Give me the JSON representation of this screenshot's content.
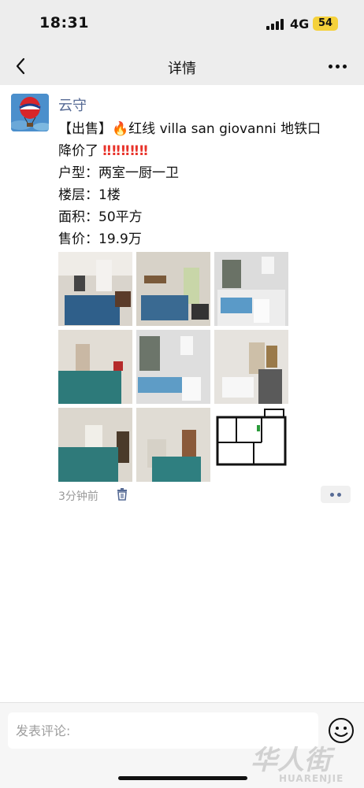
{
  "status_bar": {
    "time": "18:31",
    "network": "4G",
    "battery": "54"
  },
  "nav": {
    "title": "详情",
    "back_icon": "chevron-left-icon",
    "more_icon": "more-dots-icon"
  },
  "post": {
    "username": "云守",
    "avatar_icon": "hot-air-balloon-avatar",
    "lines": {
      "line1_prefix": "【出售】",
      "line1_text": "红线 villa san giovanni 地铁口",
      "line2_text": "降价了",
      "line3": "户型：两室一厨一卫",
      "line4": "楼层：1楼",
      "line5": "面积：50平方",
      "line6": "售价：19.9万"
    },
    "fire_emoji": "🔥",
    "exclaim_emoji": "‼‼‼‼‼",
    "photos": [
      {
        "name": "photo-bedroom-1"
      },
      {
        "name": "photo-bedroom-2"
      },
      {
        "name": "photo-bathroom-1"
      },
      {
        "name": "photo-bedroom-3"
      },
      {
        "name": "photo-bathroom-2"
      },
      {
        "name": "photo-kitchen"
      },
      {
        "name": "photo-bedroom-4"
      },
      {
        "name": "photo-bedroom-5"
      },
      {
        "name": "photo-floorplan"
      }
    ],
    "time_ago": "3分钟前"
  },
  "comment_bar": {
    "placeholder": "发表评论:",
    "watermark_cn": "华人街",
    "watermark_en": "HUARENJIE"
  },
  "colors": {
    "link_blue": "#576b95",
    "header_bg": "#ededed",
    "battery_yellow": "#f5d13b"
  }
}
